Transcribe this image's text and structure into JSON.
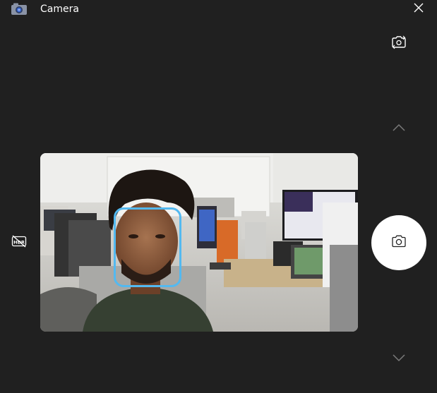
{
  "window": {
    "title": "Camera",
    "app_icon": "camera-app-icon"
  },
  "controls": {
    "close": "close-icon",
    "switch_camera": "switch-camera-icon",
    "scroll_up": "chevron-up-icon",
    "scroll_down": "chevron-down-icon",
    "hdr": "hdr-off-icon",
    "take_photo": "camera-shutter-icon"
  },
  "preview": {
    "face_detected": true
  },
  "colors": {
    "background": "#202020",
    "face_box": "#53b9f0",
    "shutter": "#ffffff"
  }
}
